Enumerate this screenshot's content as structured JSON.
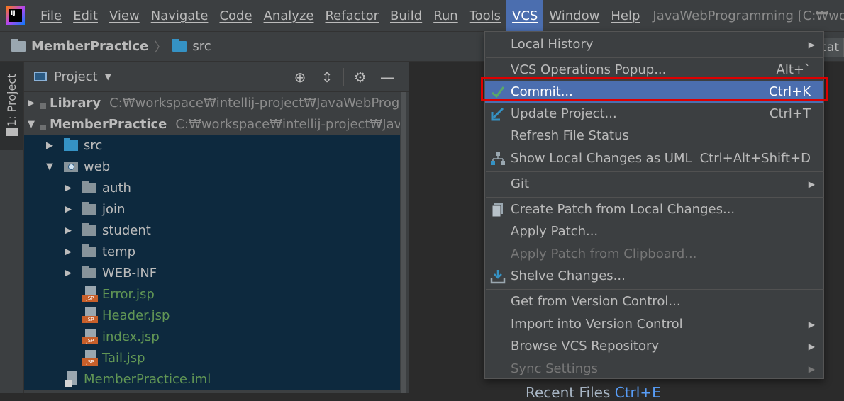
{
  "menubar": {
    "items": [
      {
        "label": "File"
      },
      {
        "label": "Edit"
      },
      {
        "label": "View"
      },
      {
        "label": "Navigate"
      },
      {
        "label": "Code"
      },
      {
        "label": "Analyze"
      },
      {
        "label": "Refactor"
      },
      {
        "label": "Build"
      },
      {
        "label": "Run"
      },
      {
        "label": "Tools"
      },
      {
        "label": "VCS"
      },
      {
        "label": "Window"
      },
      {
        "label": "Help"
      }
    ],
    "title": "JavaWebProgramming [C:₩workspace"
  },
  "navbar": {
    "crumb_project": "MemberPractice",
    "crumb_folder": "src",
    "right_text": "cat"
  },
  "sidestrip": {
    "tab_label": "1: Project"
  },
  "project_panel": {
    "header_title": "Project",
    "tree": [
      {
        "name": "Library",
        "path": "C:₩workspace₩intellij-project₩JavaWebProgrammi"
      },
      {
        "name": "MemberPractice",
        "path": "C:₩workspace₩intellij-project₩JavaWebPr"
      },
      {
        "name": "src"
      },
      {
        "name": "web"
      },
      {
        "name": "auth"
      },
      {
        "name": "join"
      },
      {
        "name": "student"
      },
      {
        "name": "temp"
      },
      {
        "name": "WEB-INF"
      },
      {
        "name": "Error.jsp"
      },
      {
        "name": "Header.jsp"
      },
      {
        "name": "index.jsp"
      },
      {
        "name": "Tail.jsp"
      },
      {
        "name": "MemberPractice.iml"
      }
    ],
    "jsp_badge": "JSP"
  },
  "editor": {
    "hint_label": "Recent Files",
    "hint_key": "Ctrl+E"
  },
  "vcs_menu": {
    "items": [
      {
        "label": "Local History",
        "shortcut": ""
      },
      {
        "label": "VCS Operations Popup...",
        "shortcut": "Alt+`"
      },
      {
        "label": "Commit...",
        "shortcut": "Ctrl+K"
      },
      {
        "label": "Update Project...",
        "shortcut": "Ctrl+T"
      },
      {
        "label": "Refresh File Status",
        "shortcut": ""
      },
      {
        "label": "Show Local Changes as UML",
        "shortcut": "Ctrl+Alt+Shift+D"
      },
      {
        "label": "Git",
        "shortcut": ""
      },
      {
        "label": "Create Patch from Local Changes...",
        "shortcut": ""
      },
      {
        "label": "Apply Patch...",
        "shortcut": ""
      },
      {
        "label": "Apply Patch from Clipboard...",
        "shortcut": ""
      },
      {
        "label": "Shelve Changes...",
        "shortcut": ""
      },
      {
        "label": "Get from Version Control...",
        "shortcut": ""
      },
      {
        "label": "Import into Version Control",
        "shortcut": ""
      },
      {
        "label": "Browse VCS Repository",
        "shortcut": ""
      },
      {
        "label": "Sync Settings",
        "shortcut": ""
      }
    ]
  },
  "colors": {
    "accent": "#4b6eaf",
    "highlight_border": "#dd0000",
    "jsp_text": "#629755",
    "background": "#2b2b2b",
    "panel": "#3c3f41"
  }
}
